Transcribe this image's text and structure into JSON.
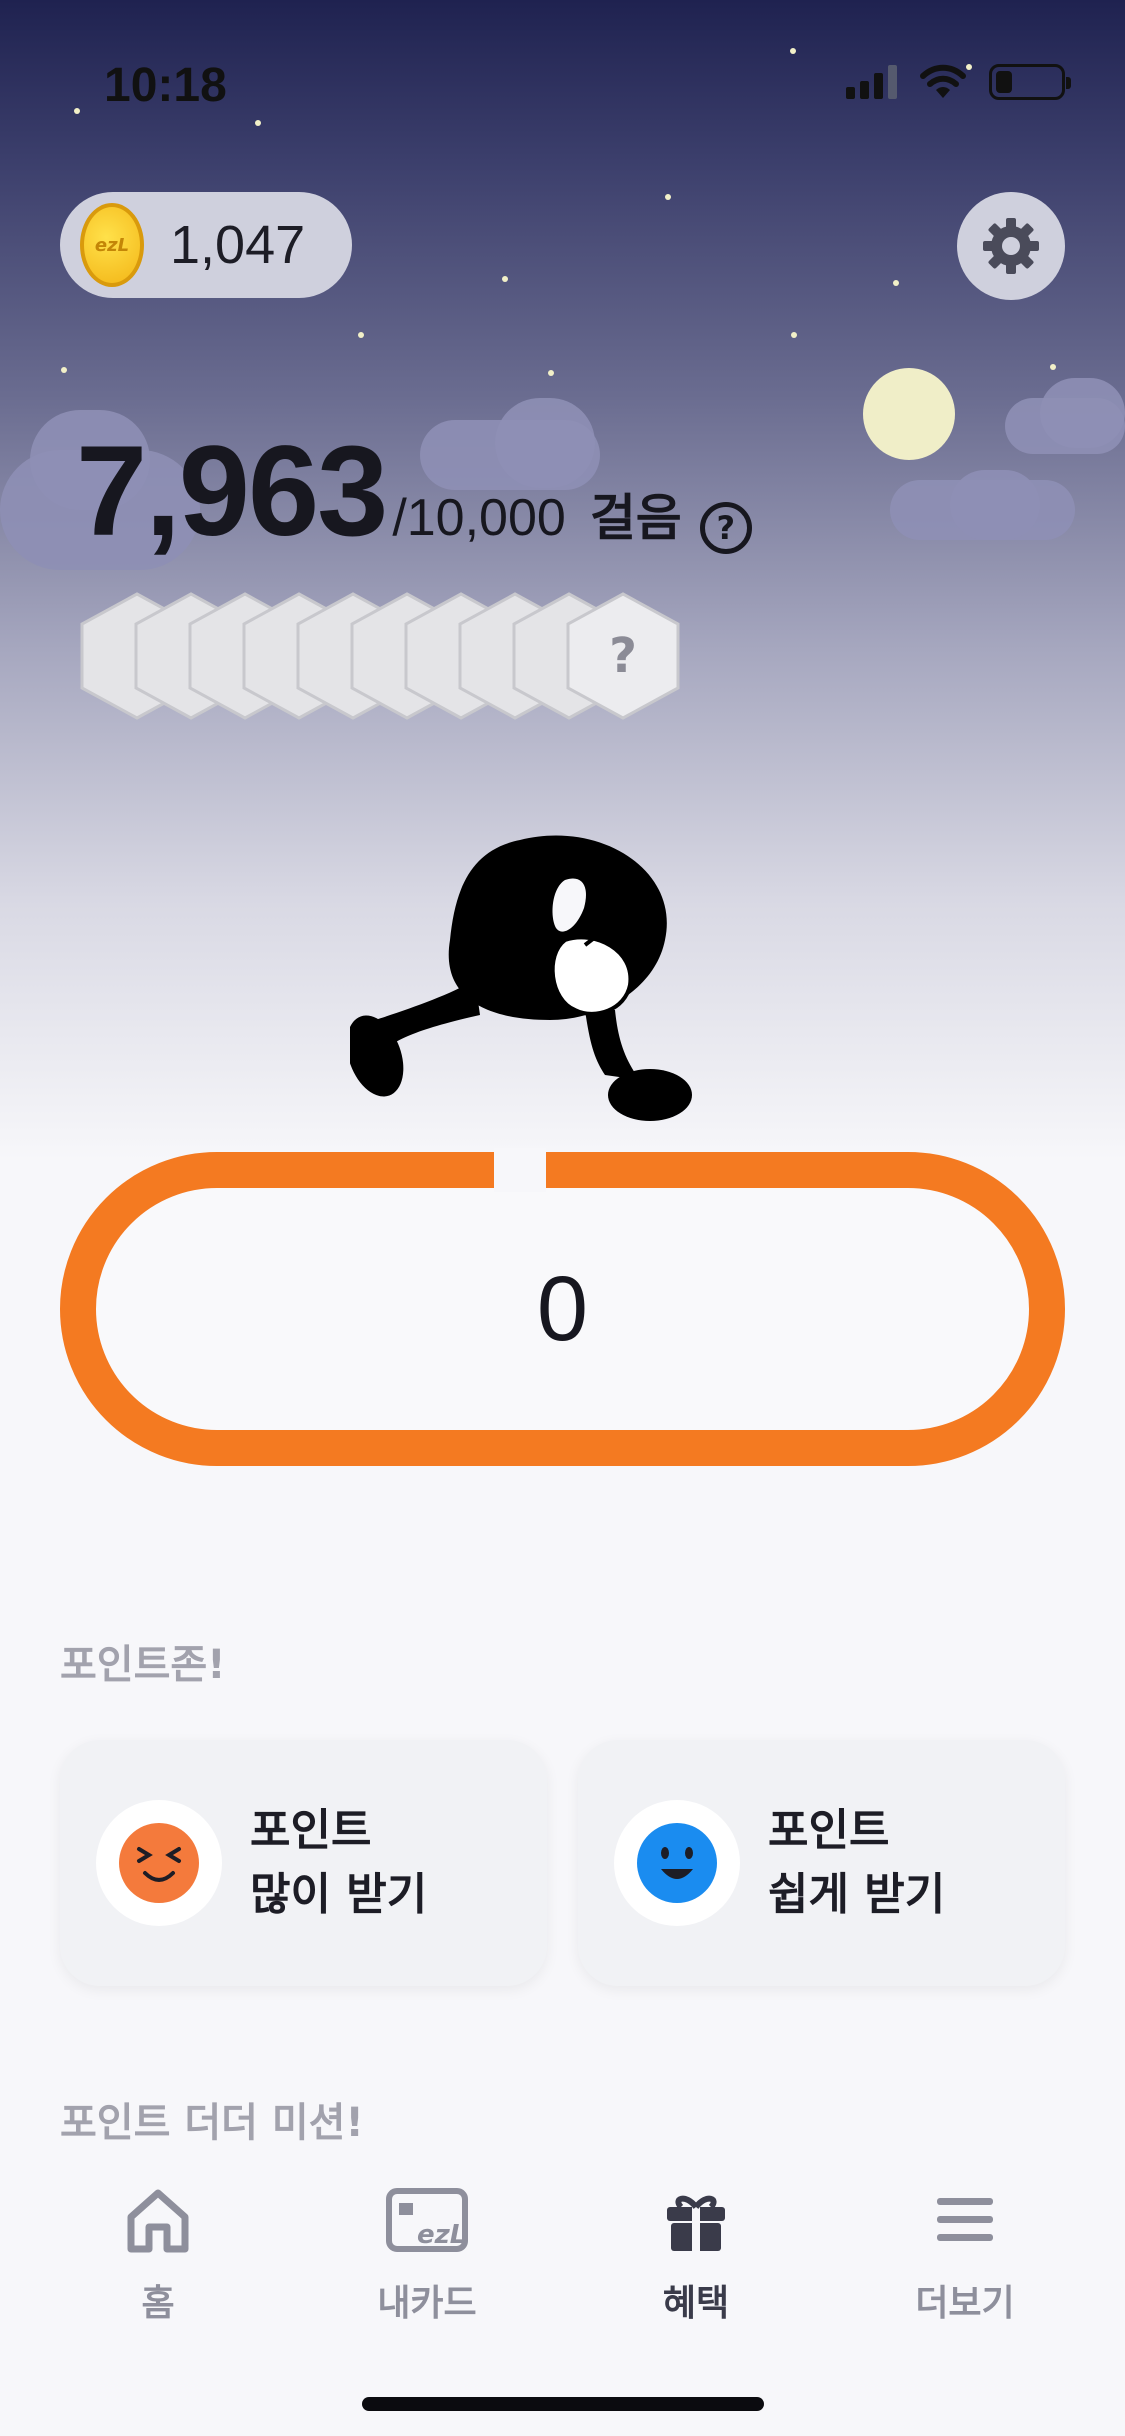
{
  "status_bar": {
    "time": "10:18"
  },
  "points": {
    "value": "1,047",
    "coin_label": "ezL"
  },
  "steps": {
    "count": "7,963",
    "goal": "/10,000",
    "unit": "걸음",
    "help_glyph": "?"
  },
  "badges": {
    "locked_glyph": "?"
  },
  "start_button": {
    "value": "0",
    "accent_color": "#f47a21"
  },
  "point_zone": {
    "title": "포인트존!",
    "cards": [
      {
        "line1": "포인트",
        "line2": "많이 받기",
        "icon": "laughing-face-icon",
        "color": "#f47a3c"
      },
      {
        "line1": "포인트",
        "line2": "쉽게 받기",
        "icon": "smiling-face-icon",
        "color": "#1a8cf0"
      }
    ]
  },
  "missions": {
    "title": "포인트 더더 미션!"
  },
  "tabbar": {
    "tabs": [
      {
        "label": "홈",
        "icon": "home-icon"
      },
      {
        "label": "내카드",
        "icon": "card-icon"
      },
      {
        "label": "혜택",
        "icon": "gift-icon"
      },
      {
        "label": "더보기",
        "icon": "menu-icon"
      }
    ],
    "active_index": 2
  }
}
